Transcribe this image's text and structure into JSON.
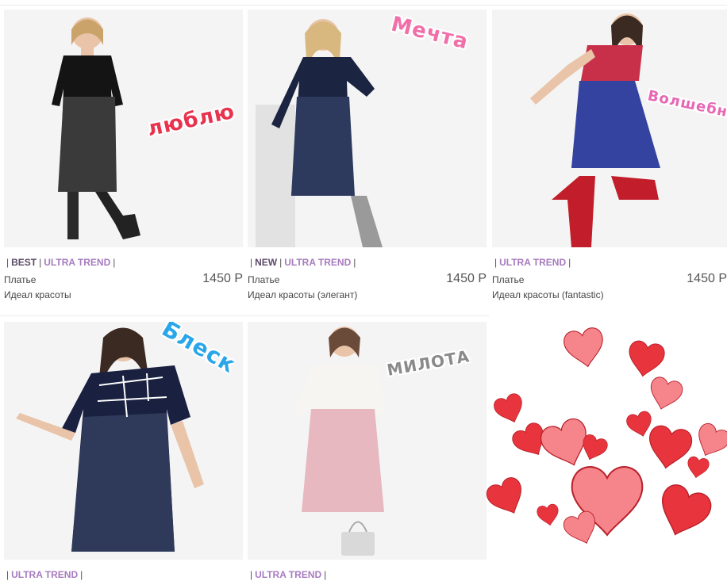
{
  "products": [
    {
      "tags": [
        "BEST",
        "ULTRA TREND"
      ],
      "type": "Платье",
      "name": "Идеал красоты",
      "price": "1450 Р",
      "sticker": "люблю",
      "sticker_color": "#e8334f",
      "dress_top": "#141414",
      "dress_bottom": "#3a3a3a"
    },
    {
      "tags": [
        "NEW",
        "ULTRA TREND"
      ],
      "type": "Платье",
      "name": "Идеал красоты (элегант)",
      "price": "1450 Р",
      "sticker": "Мечта",
      "sticker_color": "#f06fa8",
      "dress_top": "#1b2440",
      "dress_bottom": "#2d3a5e"
    },
    {
      "tags": [
        "ULTRA TREND"
      ],
      "type": "Платье",
      "name": "Идеал красоты (fantastic)",
      "price": "1450 Р",
      "sticker": "Волшебно",
      "sticker_color": "#e767b4",
      "dress_top": "#c8304a",
      "dress_bottom": "#3442a0"
    },
    {
      "tags": [
        "ULTRA TREND"
      ],
      "sticker": "Блеск",
      "sticker_color": "#2aa6e8",
      "dress_top": "#1a2040",
      "dress_bottom": "#2f3a5a"
    },
    {
      "tags": [
        "ULTRA TREND"
      ],
      "sticker": "МИЛОТА",
      "sticker_color": "#8a8a8a",
      "dress_top": "#f7f5f2",
      "dress_bottom": "#e7b8bf"
    }
  ],
  "colors": {
    "heart": "#e8343c",
    "heart_light": "#f5858a",
    "tag_primary": "#5b4a68",
    "tag_secondary": "#a77bbf"
  }
}
